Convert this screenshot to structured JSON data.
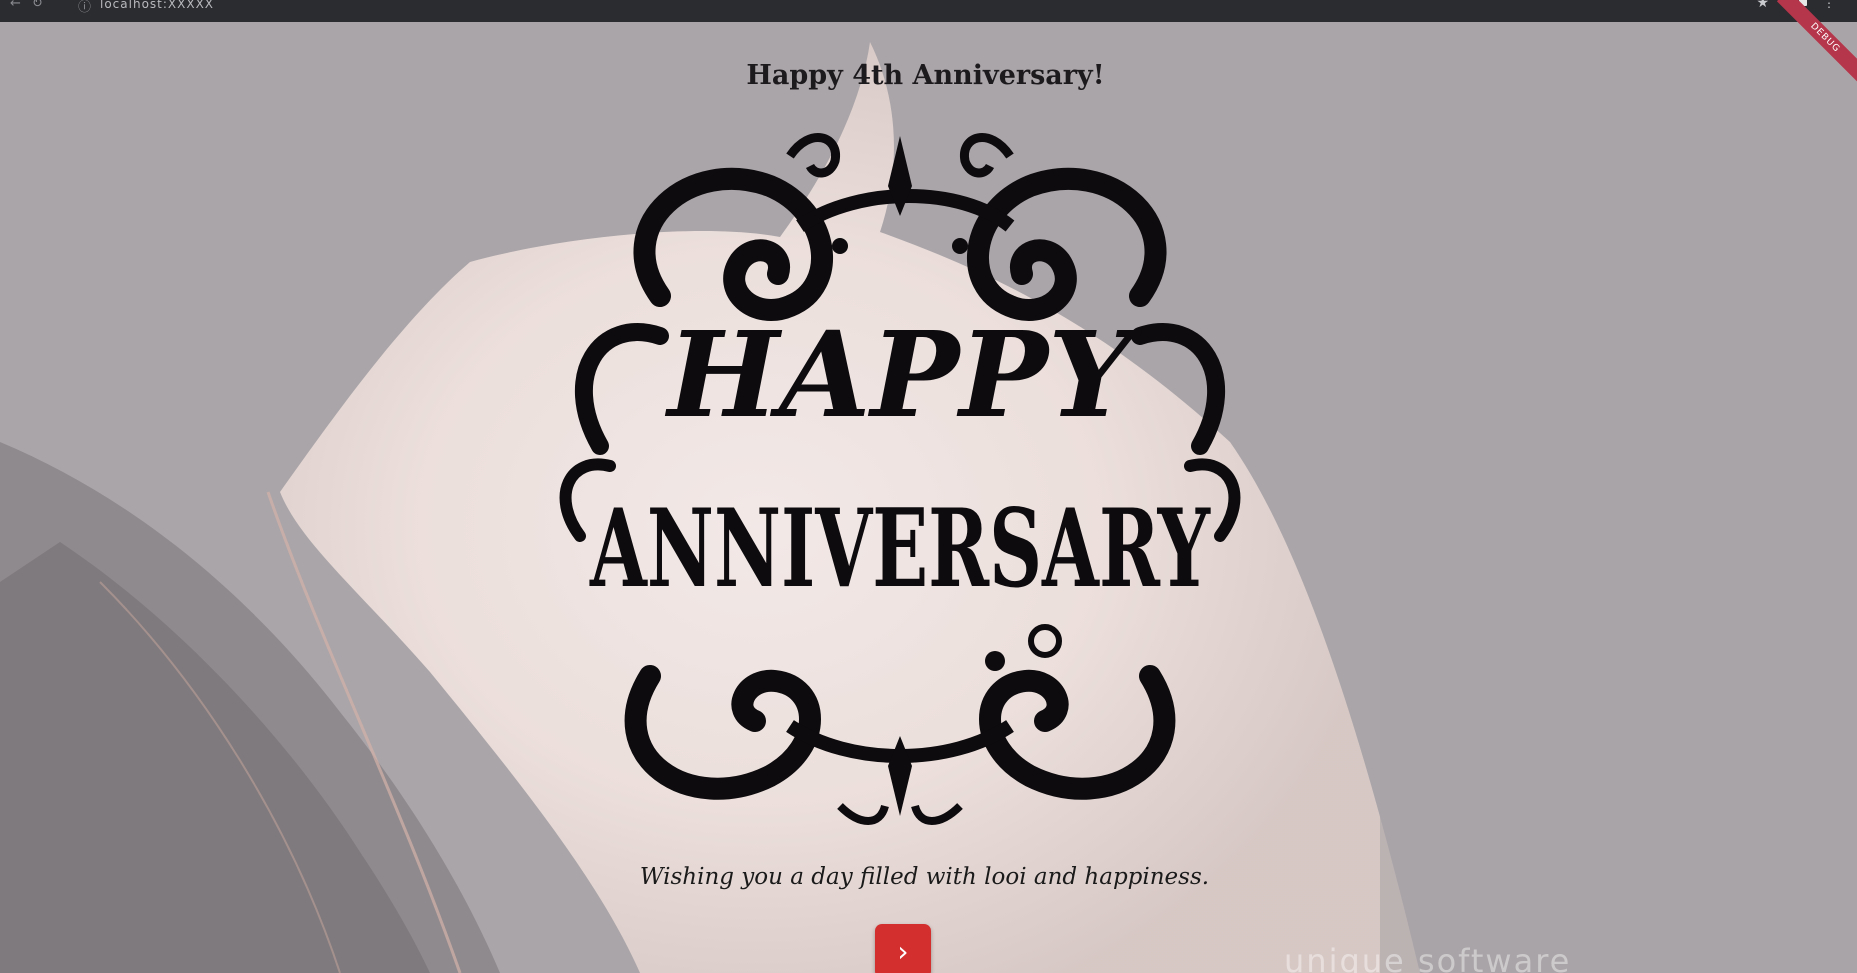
{
  "browser": {
    "url": "localhost:XXXXX",
    "nav_icons": [
      "back-arrow-icon",
      "reload-icon",
      "site-info-icon"
    ],
    "right_icons": [
      "bookmark-star-icon",
      "profile-icon",
      "menu-icon"
    ]
  },
  "debug_banner": "DEBUG",
  "card": {
    "heading": "Happy 4th Anniversary!",
    "emblem_line1": "HAPPY",
    "emblem_line2": "ANNIVERSARY",
    "message": "Wishing you a day filled with looi and happiness.",
    "next_button_glyph": "›"
  },
  "watermark": "unique software",
  "colors": {
    "background": "#a9a4a8",
    "emblem": "#0d0b0d",
    "next_button": "#d32f2f",
    "ribbon": "#b5364b"
  }
}
